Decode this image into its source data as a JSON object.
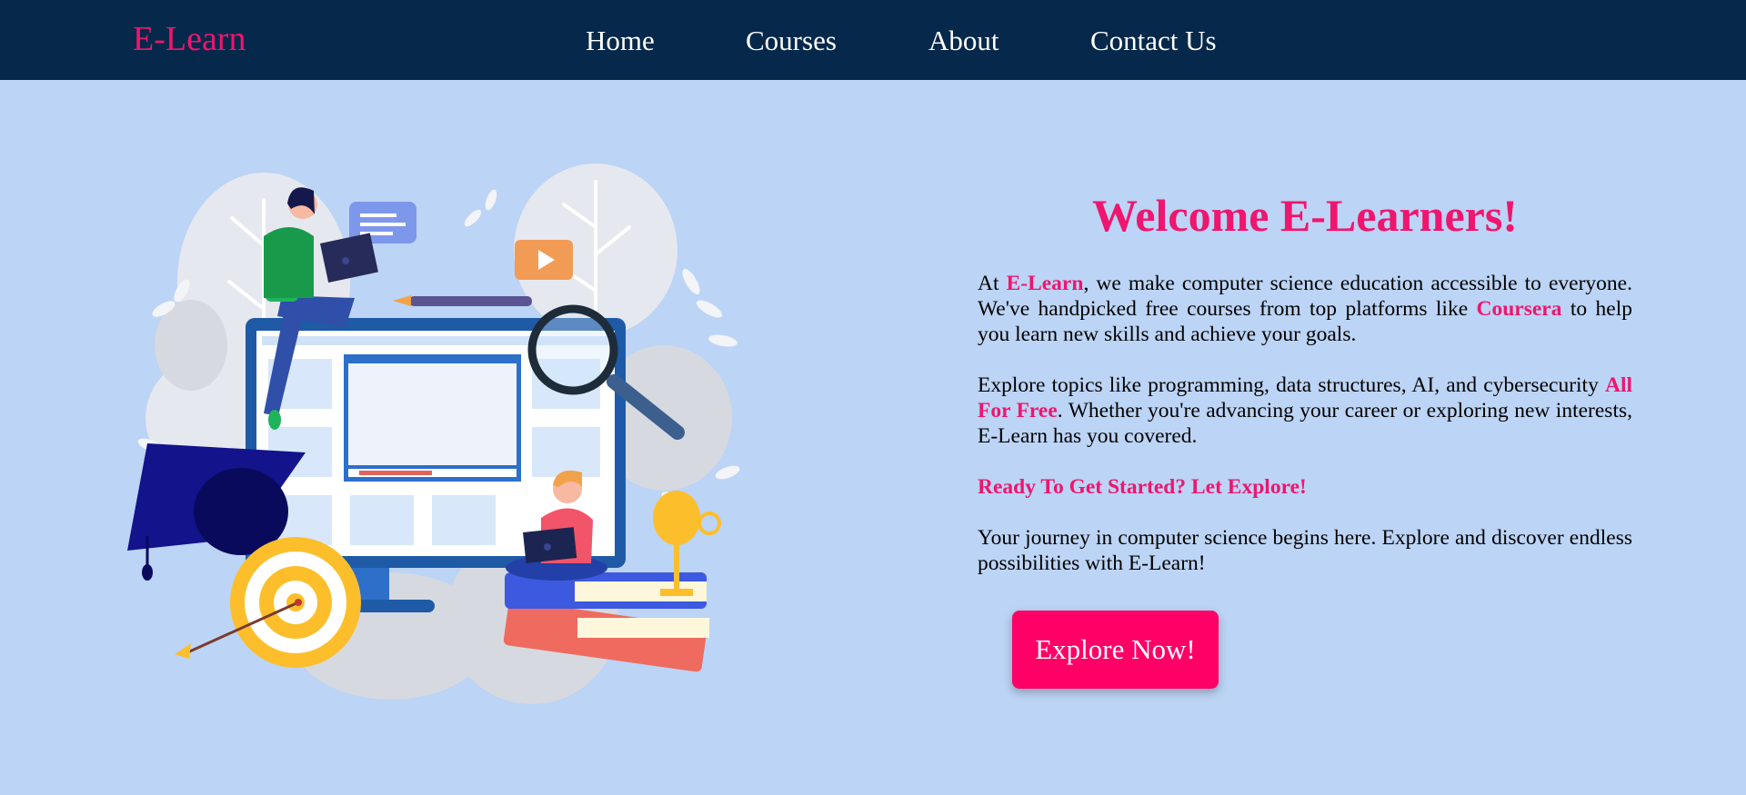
{
  "nav": {
    "brand": "E-Learn",
    "links": [
      "Home",
      "Courses",
      "About",
      "Contact Us"
    ]
  },
  "hero": {
    "title": "Welcome E-Learners!",
    "p1": {
      "t1": "At ",
      "h1": "E-Learn",
      "t2": ", we make computer science education accessible to everyone. We've handpicked free courses from top platforms like ",
      "h2": "Coursera",
      "t3": " to help you learn new skills and achieve your goals."
    },
    "p2": {
      "t1": "Explore topics like programming, data structures, AI, and cybersecurity ",
      "h1": "All For Free",
      "t2": ". Whether you're advancing your career or exploring new interests, E-Learn has you covered."
    },
    "p3": "Ready To Get Started? Let Explore!",
    "p4": "Your journey in computer science begins here. Explore and discover endless possibilities with E-Learn!",
    "cta_label": "Explore Now!"
  },
  "colors": {
    "navbar_bg": "#06284a",
    "page_bg": "#bcd4f5",
    "accent": "#f0156e",
    "button_bg": "#ff0066"
  }
}
